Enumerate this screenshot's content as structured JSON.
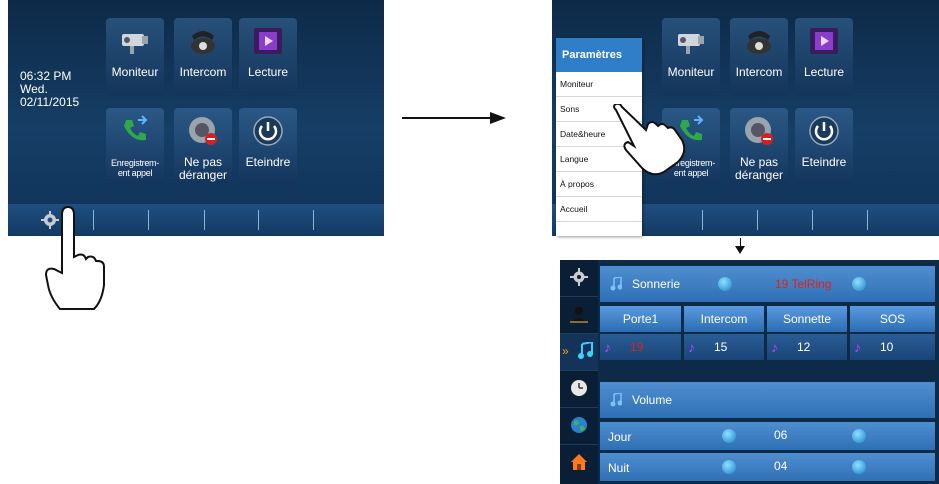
{
  "home": {
    "time": "06:32 PM",
    "day": "Wed.",
    "date": "02/11/2015",
    "tiles": [
      {
        "label": "Moniteur",
        "icon": "camera-icon"
      },
      {
        "label": "Intercom",
        "icon": "telephone-icon"
      },
      {
        "label": "Lecture",
        "icon": "film-icon"
      },
      {
        "label_line1": "Enregistrem-",
        "label_line2": "ent appel",
        "icon": "call-record-icon"
      },
      {
        "label_line1": "Ne pas",
        "label_line2": "déranger",
        "icon": "speaker-mute-icon"
      },
      {
        "label": "Eteindre",
        "icon": "power-icon"
      }
    ]
  },
  "settings_menu": {
    "title": "Paramètres",
    "items": [
      "Moniteur",
      "Sons",
      "Date&heure",
      "Langue",
      "À propos",
      "Accueil"
    ]
  },
  "sound_screen": {
    "sonnerie_label": "Sonnerie",
    "sonnerie_value": "19 TelRing",
    "columns": [
      "Porte1",
      "Intercom",
      "Sonnette",
      "SOS"
    ],
    "column_values": [
      "19",
      "15",
      "12",
      "10"
    ],
    "volume_label": "Volume",
    "jour_label": "Jour",
    "jour_value": "06",
    "nuit_label": "Nuit",
    "nuit_value": "04"
  },
  "colors": {
    "screen_bg": "#163e66",
    "accent": "#2f7fc8",
    "highlight_red": "#e12020"
  }
}
